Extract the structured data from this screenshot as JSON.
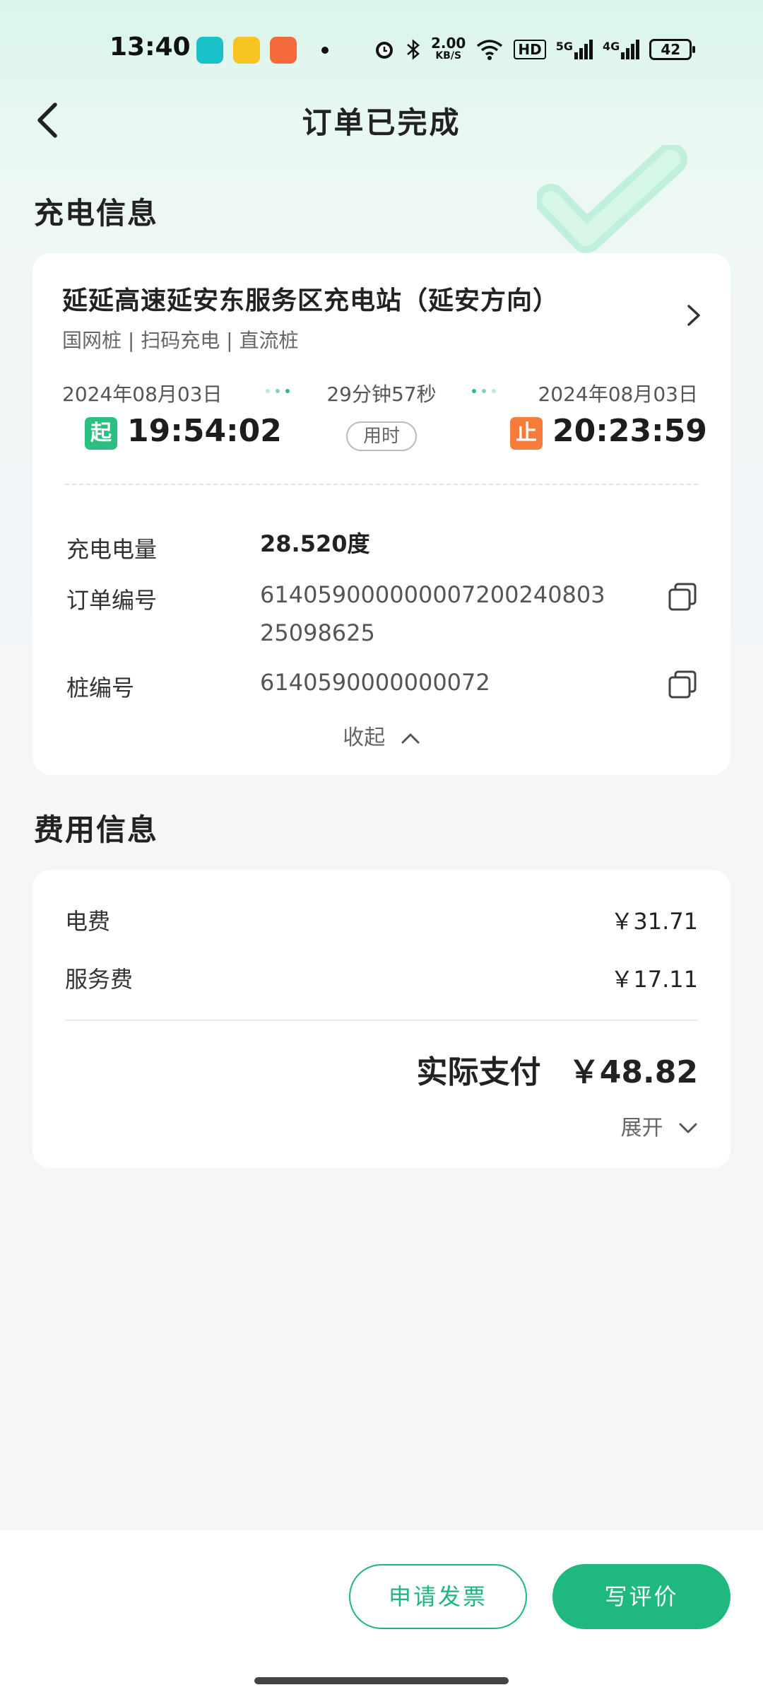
{
  "status_bar": {
    "time": "13:40",
    "net_speed_value": "2.00",
    "net_speed_unit": "KB/S",
    "hd": "HD",
    "signal_1": "5G",
    "signal_2": "4G",
    "battery": "42",
    "icons": [
      "home-app-icon",
      "seven-app-icon",
      "pig-app-icon",
      "alarm-icon",
      "bluetooth-icon",
      "wifi-icon"
    ]
  },
  "header": {
    "title": "订单已完成"
  },
  "charging_info": {
    "section_title": "充电信息",
    "station_name": "延延高速延安东服务区充电站（延安方向）",
    "tags": "国网桩 | 扫码充电 | 直流桩",
    "start_date": "2024年08月03日",
    "end_date": "2024年08月03日",
    "duration": "29分钟57秒",
    "start_badge": "起",
    "end_badge": "止",
    "start_time": "19:54:02",
    "end_time": "20:23:59",
    "used_label": "用时",
    "rows": [
      {
        "label": "充电电量",
        "value": "28.520度"
      },
      {
        "label": "订单编号",
        "value_line1": "614059000000007200240803",
        "value_line2": "25098625"
      },
      {
        "label": "桩编号",
        "value": "6140590000000072"
      }
    ],
    "collapse_label": "收起"
  },
  "fee_info": {
    "section_title": "费用信息",
    "electricity_label": "电费",
    "electricity_value": "￥31.71",
    "service_label": "服务费",
    "service_value": "￥17.11",
    "total_label": "实际支付",
    "total_value": "￥48.82",
    "expand_label": "展开"
  },
  "actions": {
    "invoice_label": "申请发票",
    "review_label": "写评价"
  },
  "colors": {
    "accent": "#1fb87e",
    "start_badge": "#2bc07f",
    "end_badge": "#f77b3a"
  }
}
